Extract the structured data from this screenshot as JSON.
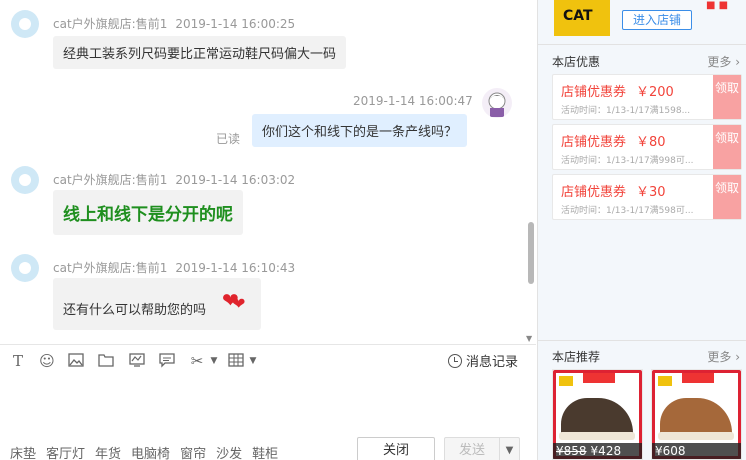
{
  "messages": [
    {
      "sender": "cat户外旗舰店:售前1",
      "time": "2019-1-14 16:00:25",
      "text": "经典工装系列尺码要比正常运动鞋尺码偏大一码"
    },
    {
      "sender": "",
      "time": "2019-1-14 16:00:47",
      "text": "你们这个和线下的是一条产线吗？",
      "read_status": "已读"
    },
    {
      "sender": "cat户外旗舰店:售前1",
      "time": "2019-1-14 16:03:02",
      "text": "线上和线下是分开的呢"
    },
    {
      "sender": "cat户外旗舰店:售前1",
      "time": "2019-1-14 16:10:43",
      "text": "还有什么可以帮助您的吗"
    }
  ],
  "toolbar": {
    "icons": [
      "text-format-icon",
      "emoji-icon",
      "image-icon",
      "folder-icon",
      "screen-icon",
      "comment-icon",
      "scissors-icon",
      "table-icon"
    ],
    "history_label": "消息记录"
  },
  "keywords": [
    "床垫",
    "客厅灯",
    "年货",
    "电脑椅",
    "窗帘",
    "沙发",
    "鞋柜"
  ],
  "buttons": {
    "close": "关闭",
    "send": "发送"
  },
  "side": {
    "logo_text": "CAT",
    "enter_shop": "进入店铺",
    "coupons_title": "本店优惠",
    "more": "更多",
    "coupons": [
      {
        "title": "店铺优惠券",
        "amount": "￥200",
        "cond": "活动时间：1/13-1/17满1598...",
        "get": "领取"
      },
      {
        "title": "店铺优惠券",
        "amount": "￥80",
        "cond": "活动时间：1/13-1/17满998可...",
        "get": "领取"
      },
      {
        "title": "店铺优惠券",
        "amount": "￥30",
        "cond": "活动时间：1/13-1/17满598可...",
        "get": "领取"
      }
    ],
    "recommend_title": "本店推荐",
    "products": [
      {
        "old_price": "¥858",
        "price": "¥428"
      },
      {
        "old_price": "",
        "price": "¥608"
      }
    ]
  },
  "colors": {
    "accent": "#3b8ee8",
    "coupon_red": "#f2443b",
    "green_text": "#1f8f1f"
  }
}
